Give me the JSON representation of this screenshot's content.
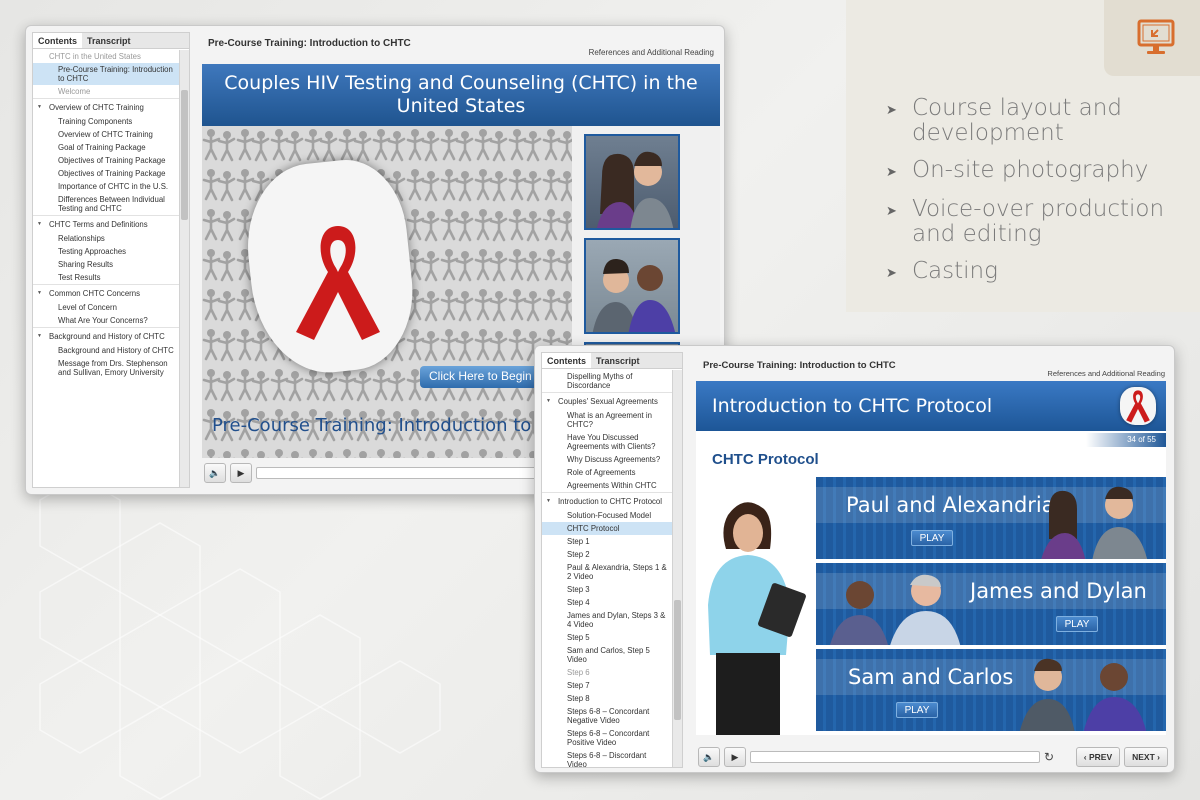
{
  "features": {
    "items": [
      "Course layout and development",
      "On-site photography",
      "Voice-over production and editing",
      "Casting"
    ]
  },
  "colors": {
    "accent": "#1f5a9e",
    "icon": "#d86e2e",
    "ribbon": "#cc1b1b"
  },
  "window1": {
    "tabs": [
      "Contents",
      "Transcript"
    ],
    "toc": [
      {
        "type": "item",
        "label": "CHTC in the United States",
        "style": "dim",
        "indent": "sec"
      },
      {
        "type": "item",
        "label": "Pre-Course Training: Introduction to CHTC",
        "style": "sel"
      },
      {
        "type": "item",
        "label": "Welcome",
        "style": "dim"
      },
      {
        "type": "sec",
        "label": "Overview of CHTC Training"
      },
      {
        "type": "item",
        "label": "Training Components"
      },
      {
        "type": "item",
        "label": "Overview of CHTC Training"
      },
      {
        "type": "item",
        "label": "Goal of Training Package"
      },
      {
        "type": "item",
        "label": "Objectives of Training Package"
      },
      {
        "type": "item",
        "label": "Objectives of Training Package"
      },
      {
        "type": "item",
        "label": "Importance of CHTC in the U.S."
      },
      {
        "type": "item",
        "label": "Differences Between Individual Testing and CHTC"
      },
      {
        "type": "sec",
        "label": "CHTC Terms and Definitions"
      },
      {
        "type": "item",
        "label": "Relationships"
      },
      {
        "type": "item",
        "label": "Testing Approaches"
      },
      {
        "type": "item",
        "label": "Sharing Results"
      },
      {
        "type": "item",
        "label": "Test Results"
      },
      {
        "type": "sec",
        "label": "Common CHTC Concerns"
      },
      {
        "type": "item",
        "label": "Level of Concern"
      },
      {
        "type": "item",
        "label": "What Are Your Concerns?"
      },
      {
        "type": "sec",
        "label": "Background and History of CHTC"
      },
      {
        "type": "item",
        "label": "Background and History of CHTC"
      },
      {
        "type": "item",
        "label": "Message from Drs. Stephenson and Sullivan, Emory University"
      }
    ],
    "title": "Pre-Course Training: Introduction to CHTC",
    "references": "References and Additional Reading",
    "slide": {
      "banner": "Couples HIV Testing and Counseling (CHTC) in the United States",
      "button": "Click Here to Begin",
      "subtitle": "Pre-Course Training: Introduction to CHTC"
    }
  },
  "window2": {
    "tabs": [
      "Contents",
      "Transcript"
    ],
    "toc": [
      {
        "type": "item",
        "label": "Dispelling Myths of Discordance"
      },
      {
        "type": "sec",
        "label": "Couples' Sexual Agreements"
      },
      {
        "type": "item",
        "label": "What is an Agreement in CHTC?"
      },
      {
        "type": "item",
        "label": "Have You Discussed Agreements with Clients?"
      },
      {
        "type": "item",
        "label": "Why Discuss Agreements?"
      },
      {
        "type": "item",
        "label": "Role of Agreements"
      },
      {
        "type": "item",
        "label": "Agreements Within CHTC"
      },
      {
        "type": "sec",
        "label": "Introduction to CHTC Protocol"
      },
      {
        "type": "item",
        "label": "Solution-Focused Model"
      },
      {
        "type": "item",
        "label": "CHTC Protocol",
        "style": "sel"
      },
      {
        "type": "item",
        "label": "Step 1"
      },
      {
        "type": "item",
        "label": "Step 2"
      },
      {
        "type": "item",
        "label": "Paul & Alexandria, Steps 1 & 2 Video"
      },
      {
        "type": "item",
        "label": "Step 3"
      },
      {
        "type": "item",
        "label": "Step 4"
      },
      {
        "type": "item",
        "label": "James and Dylan, Steps 3 & 4 Video"
      },
      {
        "type": "item",
        "label": "Step 5"
      },
      {
        "type": "item",
        "label": "Sam and Carlos, Step 5 Video"
      },
      {
        "type": "item",
        "label": "Step 6",
        "style": "dim"
      },
      {
        "type": "item",
        "label": "Step 7"
      },
      {
        "type": "item",
        "label": "Step 8"
      },
      {
        "type": "item",
        "label": "Steps 6-8 – Concordant Negative Video"
      },
      {
        "type": "item",
        "label": "Steps 6-8 – Concordant Positive Video"
      },
      {
        "type": "item",
        "label": "Steps 6-8 – Discordant Video"
      }
    ],
    "title": "Pre-Course Training: Introduction to CHTC",
    "references": "References and Additional Reading",
    "slide": {
      "banner": "Introduction to CHTC Protocol",
      "counter": "34 of 55",
      "heading": "CHTC Protocol",
      "cards": [
        {
          "name": "Paul and Alexandria",
          "play": "PLAY"
        },
        {
          "name": "James and Dylan",
          "play": "PLAY"
        },
        {
          "name": "Sam and Carlos",
          "play": "PLAY"
        }
      ]
    },
    "nav": {
      "prev": "PREV",
      "next": "NEXT"
    }
  }
}
